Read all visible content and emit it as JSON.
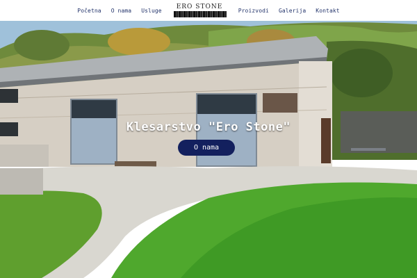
{
  "nav": {
    "left_items": [
      {
        "label": "Početna"
      },
      {
        "label": "O nama"
      },
      {
        "label": "Usluge"
      }
    ],
    "logo_text": "ERO STONE",
    "right_items": [
      {
        "label": "Proizvodi"
      },
      {
        "label": "Galerija"
      },
      {
        "label": "Kontakt"
      }
    ]
  },
  "hero": {
    "title": "Klesarstvo \"Ero Stone\"",
    "button_label": "O nama"
  },
  "colors": {
    "nav_text": "#23346b",
    "button_bg": "#13205e",
    "title_text": "#ffffff"
  }
}
